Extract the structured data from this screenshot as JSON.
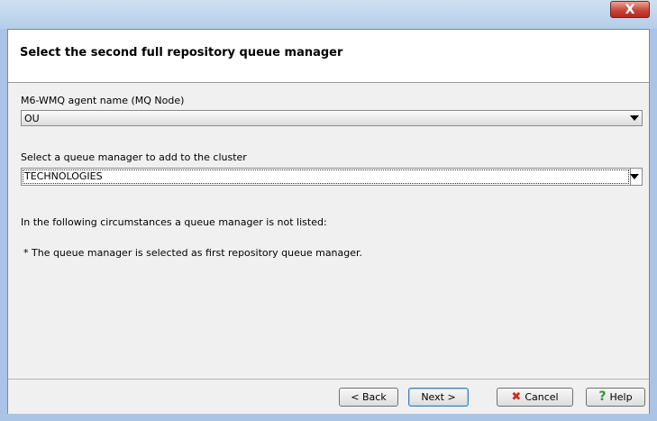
{
  "window": {
    "close_glyph": "X"
  },
  "header": {
    "title": "Select the second full repository queue manager"
  },
  "form": {
    "agent_label": "M6-WMQ agent name (MQ Node)",
    "agent_value": "OU",
    "qm_label": "Select a queue manager to add to the cluster",
    "qm_value": "TECHNOLOGIES",
    "note_intro": "In the following circumstances a queue manager is not listed:",
    "note_item": "* The queue manager is selected as first repository queue manager."
  },
  "footer": {
    "back_label": "< Back",
    "next_label": "Next >",
    "cancel_label": "Cancel",
    "help_label": "Help"
  },
  "icons": {
    "cancel": "cancel-x-icon",
    "help": "help-question-icon"
  }
}
